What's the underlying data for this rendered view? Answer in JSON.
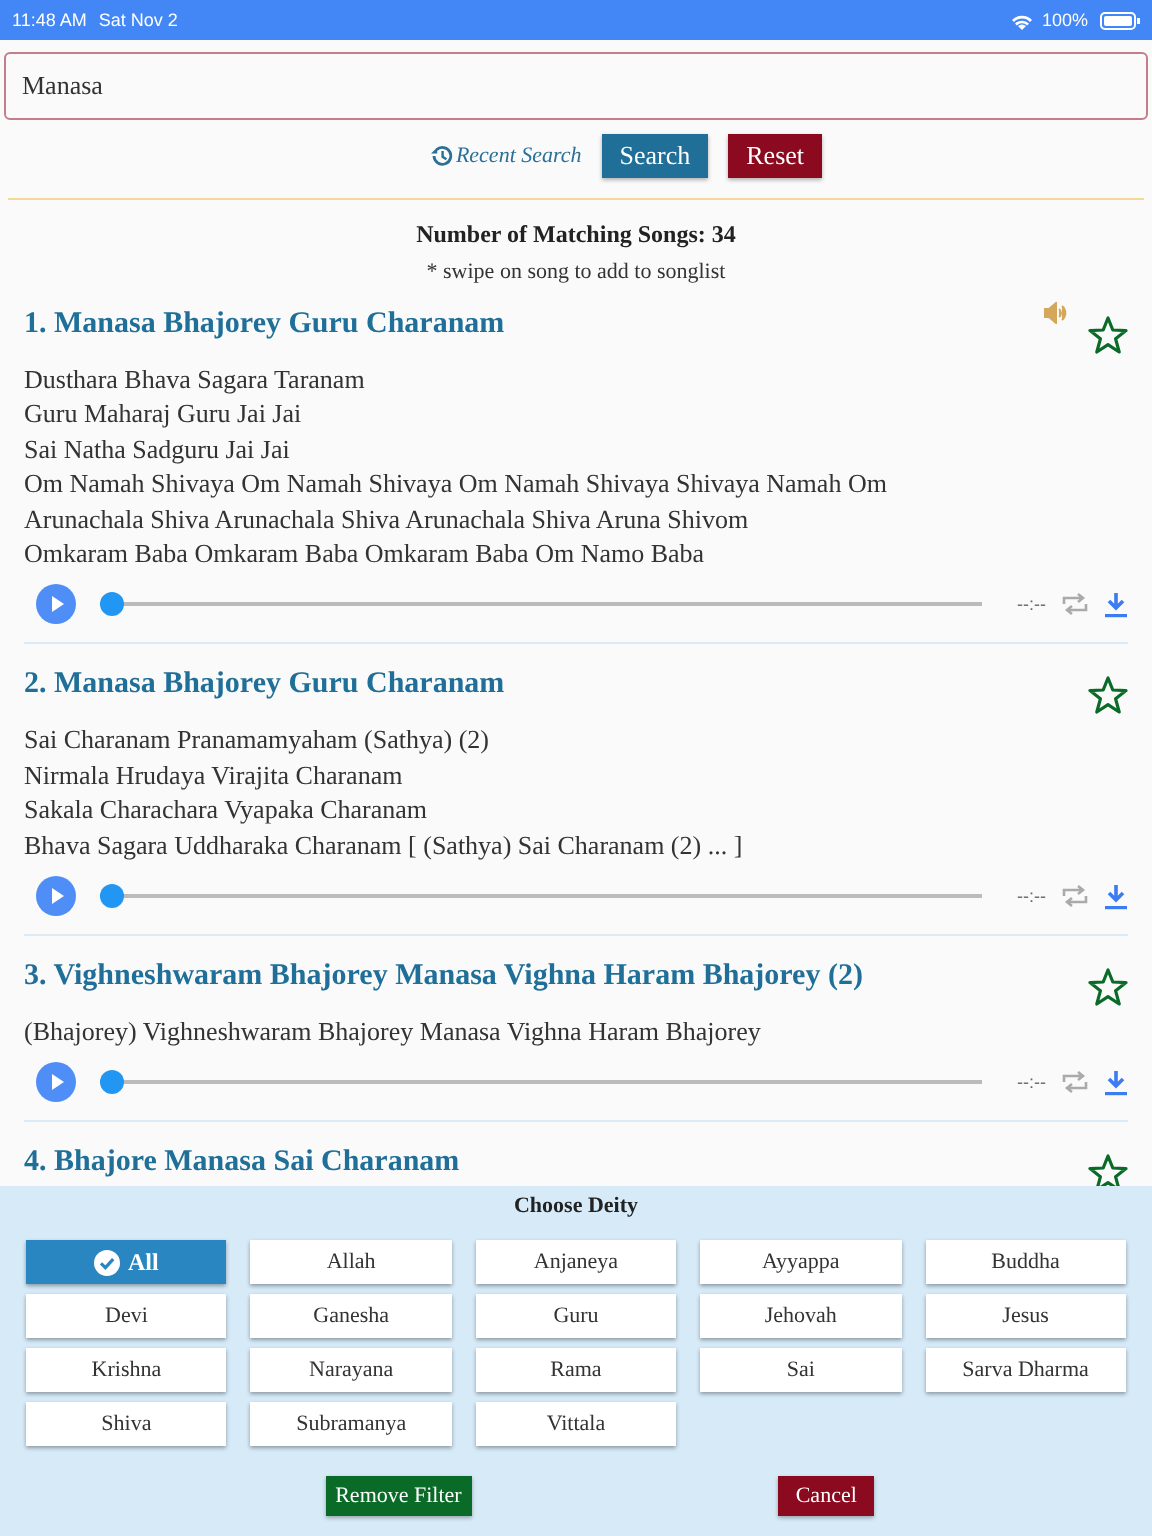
{
  "status_bar": {
    "time": "11:48 AM",
    "date": "Sat Nov 2",
    "battery": "100%"
  },
  "search": {
    "value": "Manasa",
    "recent_label": "Recent Search",
    "buttons": [
      "Search",
      "Reset"
    ]
  },
  "results": {
    "count_label": "Number of Matching Songs: 34",
    "hint": "* swipe on song to add to songlist"
  },
  "songs": [
    {
      "title": "1. Manasa Bhajorey Guru Charanam",
      "speaker": true,
      "favorite": false,
      "lyrics": [
        "Dusthara Bhava Sagara Taranam",
        "Guru Maharaj Guru Jai Jai",
        "Sai Natha Sadguru Jai Jai",
        "Om Namah Shivaya Om Namah Shivaya Om Namah Shivaya Shivaya Namah Om",
        "Arunachala Shiva Arunachala Shiva Arunachala Shiva Aruna Shivom",
        "Omkaram Baba Omkaram Baba Omkaram Baba Om Namo Baba"
      ],
      "player": {
        "time": "--:--",
        "level": 0
      }
    },
    {
      "title": "2. Manasa Bhajorey Guru Charanam",
      "speaker": false,
      "favorite": false,
      "lyrics": [
        "Sai Charanam Pranamamyaham (Sathya) (2)",
        "Nirmala Hrudaya Virajita Charanam",
        "Sakala Charachara Vyapaka Charanam",
        "Bhava Sagara Uddharaka Charanam [ (Sathya) Sai Charanam (2) ... ]"
      ],
      "player": {
        "time": "--:--",
        "level": 0
      }
    },
    {
      "title": "3. Vighneshwaram Bhajorey Manasa Vighna Haram Bhajorey (2)",
      "speaker": false,
      "favorite": false,
      "lyrics": [
        "(Bhajorey) Vighneshwaram Bhajorey Manasa Vighna Haram Bhajorey"
      ],
      "player": {
        "time": "--:--",
        "level": 0
      }
    },
    {
      "title": "4. Bhajore Manasa Sai Charanam",
      "speaker": false,
      "favorite": false
    }
  ],
  "deity_panel": {
    "title": "Choose Deity",
    "options": [
      {
        "label": "All",
        "selected": true
      },
      {
        "label": "Allah",
        "selected": false
      },
      {
        "label": "Anjaneya",
        "selected": false
      },
      {
        "label": "Ayyappa",
        "selected": false
      },
      {
        "label": "Buddha",
        "selected": false
      },
      {
        "label": "Devi",
        "selected": false
      },
      {
        "label": "Ganesha",
        "selected": false
      },
      {
        "label": "Guru",
        "selected": false
      },
      {
        "label": "Jehovah",
        "selected": false
      },
      {
        "label": "Jesus",
        "selected": false
      },
      {
        "label": "Krishna",
        "selected": false
      },
      {
        "label": "Narayana",
        "selected": false
      },
      {
        "label": "Rama",
        "selected": false
      },
      {
        "label": "Sai",
        "selected": false
      },
      {
        "label": "Sarva Dharma",
        "selected": false
      },
      {
        "label": "Shiva",
        "selected": false
      },
      {
        "label": "Subramanya",
        "selected": false
      },
      {
        "label": "Vittala",
        "selected": false
      }
    ],
    "buttons": [
      {
        "kind": "remove",
        "label": "Remove Filter"
      },
      {
        "kind": "cancel",
        "label": "Cancel"
      }
    ]
  }
}
